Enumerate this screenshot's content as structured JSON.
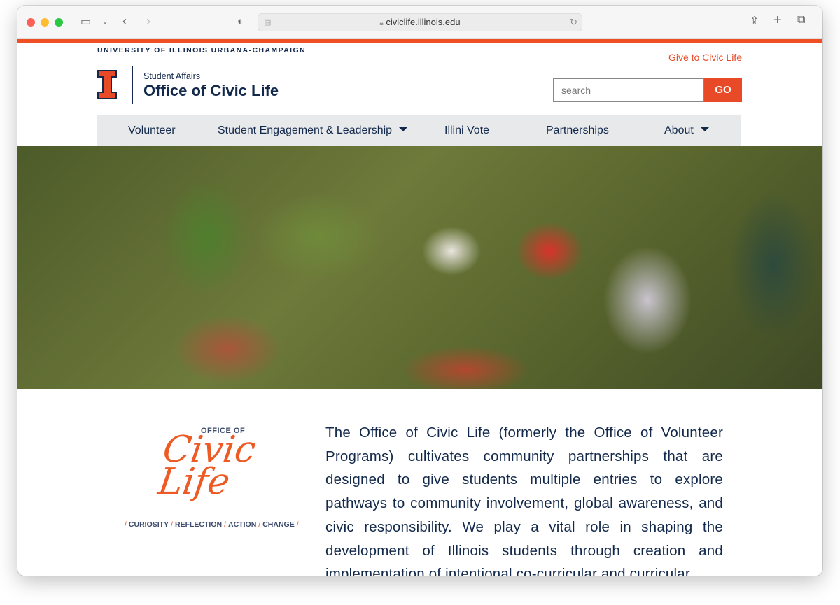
{
  "browser": {
    "url": "civiclife.illinois.edu"
  },
  "header": {
    "university": "UNIVERSITY OF ILLINOIS URBANA-CHAMPAIGN",
    "give_link": "Give to Civic Life",
    "department": "Student Affairs",
    "site_title": "Office of Civic Life",
    "search_placeholder": "search",
    "go_label": "GO"
  },
  "nav": {
    "items": [
      {
        "label": "Volunteer",
        "dropdown": false
      },
      {
        "label": "Student Engagement & Leadership",
        "dropdown": true
      },
      {
        "label": "Illini Vote",
        "dropdown": false
      },
      {
        "label": "Partnerships",
        "dropdown": false
      },
      {
        "label": "About",
        "dropdown": true
      }
    ]
  },
  "logo": {
    "top": "OFFICE OF",
    "script": "Civic Life",
    "tagline": [
      "CURIOSITY",
      "REFLECTION",
      "ACTION",
      "CHANGE"
    ]
  },
  "intro": "The Office of Civic Life (formerly the Office of Volunteer Programs) cultivates community partnerships that are designed to give students multiple entries to explore pathways to community involvement, global awareness, and civic responsibility. We play a vital role in shaping the development of Illinois students through creation and implementation of intentional co-curricular and curricular",
  "colors": {
    "orange": "#e84a27",
    "navy": "#13294b"
  }
}
